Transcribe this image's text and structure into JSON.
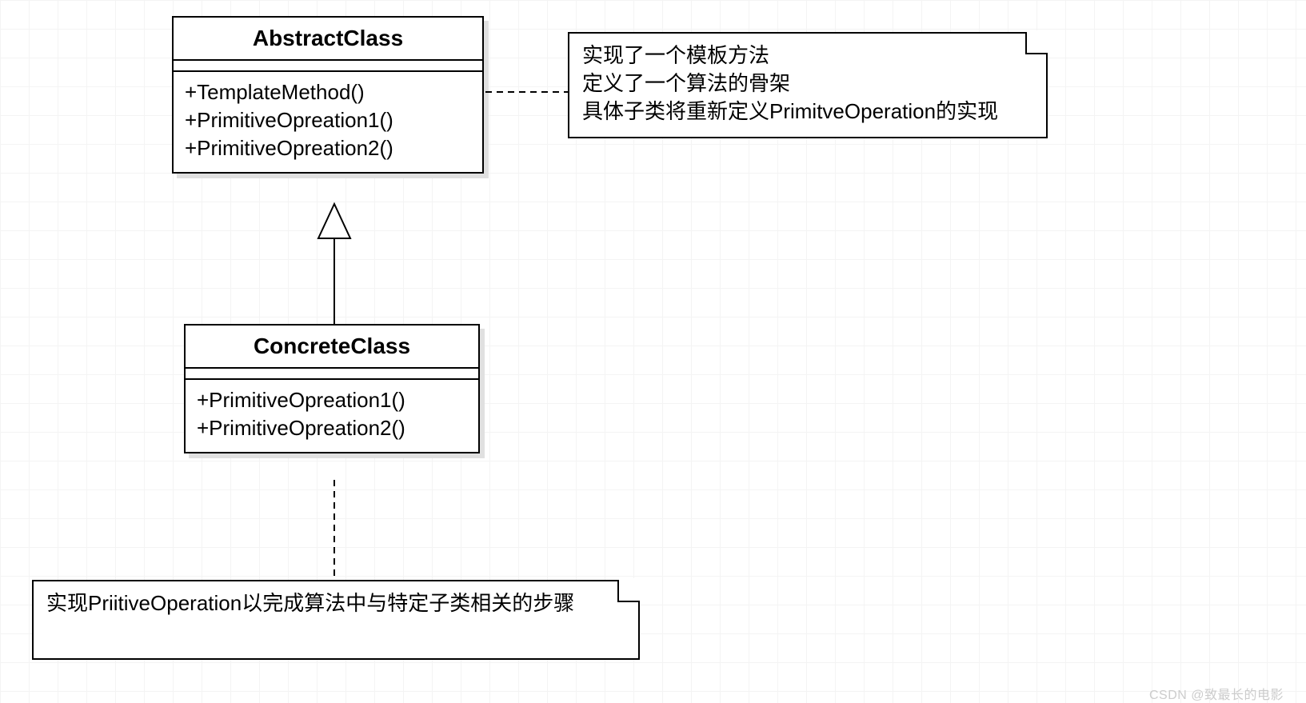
{
  "classes": {
    "abstract": {
      "name": "AbstractClass",
      "methods": [
        "+TemplateMethod()",
        "+PrimitiveOpreation1()",
        "+PrimitiveOpreation2()"
      ]
    },
    "concrete": {
      "name": "ConcreteClass",
      "methods": [
        "+PrimitiveOpreation1()",
        "+PrimitiveOpreation2()"
      ]
    }
  },
  "notes": {
    "abstract_note": {
      "lines": [
        "实现了一个模板方法",
        "定义了一个算法的骨架",
        "具体子类将重新定义PrimitveOperation的实现"
      ]
    },
    "concrete_note": {
      "lines": [
        "实现PriitiveOperation以完成算法中与特定子类相关的步骤"
      ]
    }
  },
  "watermark": "CSDN @致最长的电影"
}
